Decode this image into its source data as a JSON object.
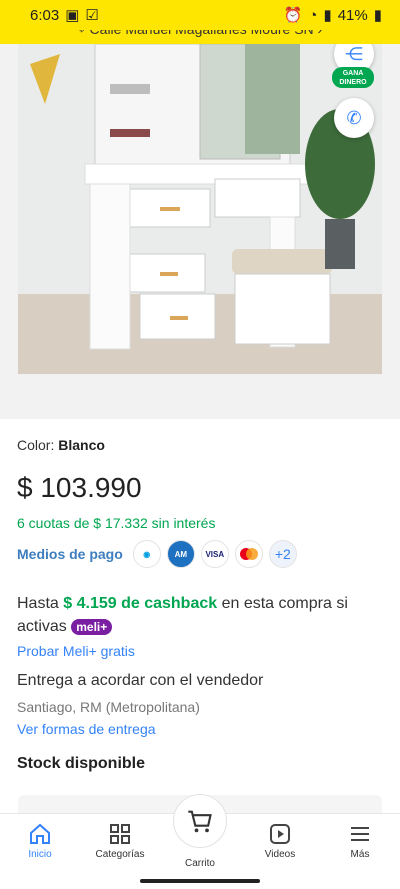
{
  "status_bar": {
    "time": "6:03",
    "battery": "41%"
  },
  "address": {
    "text": "Calle Manuel Magallanes Moure SN"
  },
  "actions": {
    "gana_dinero": "GANA DINERO"
  },
  "product": {
    "color_label": "Color:",
    "color_value": "Blanco",
    "price": "$ 103.990",
    "installments": "6 cuotas de $ 17.332 sin interés",
    "payment_methods_label": "Medios de pago",
    "payment_more": "+2",
    "cashback_prefix": "Hasta",
    "cashback_value": "$ 4.159 de cashback",
    "cashback_suffix": "en esta compra si activas",
    "meli_badge": "meli+",
    "try_meli": "Probar Meli+ gratis",
    "delivery": "Entrega a acordar con el vendedor",
    "location": "Santiago, RM (Metropolitana)",
    "delivery_link": "Ver formas de entrega",
    "stock": "Stock disponible"
  },
  "bottom_nav": [
    {
      "label": "Inicio",
      "icon": "home-icon",
      "active": true
    },
    {
      "label": "Categorías",
      "icon": "grid-icon",
      "active": false
    },
    {
      "label": "Carrito",
      "icon": "cart-icon",
      "active": false
    },
    {
      "label": "Videos",
      "icon": "play-icon",
      "active": false
    },
    {
      "label": "Más",
      "icon": "menu-icon",
      "active": false
    }
  ],
  "colors": {
    "brand_yellow": "#ffe600",
    "link_blue": "#3483fa",
    "green": "#00a650",
    "meli_purple": "#7a1fa2"
  }
}
